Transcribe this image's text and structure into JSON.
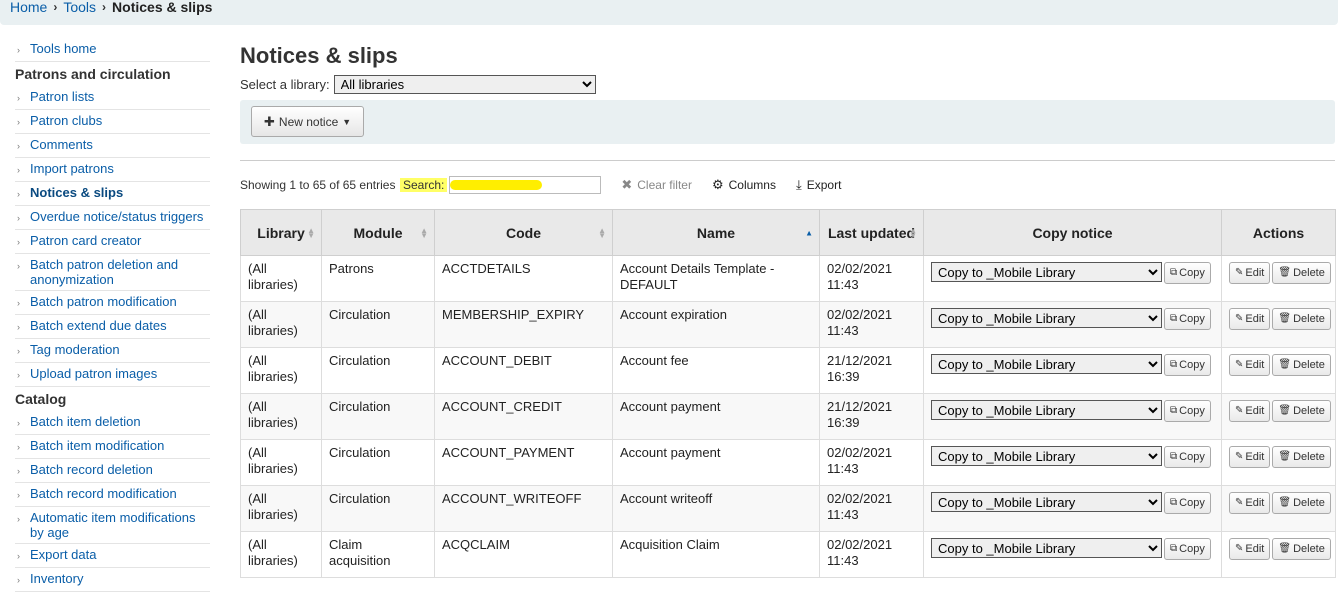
{
  "breadcrumb": {
    "home": "Home",
    "tools": "Tools",
    "current": "Notices & slips",
    "separator": "›"
  },
  "sidebar": {
    "tools_home": "Tools home",
    "sections": [
      {
        "heading": "Patrons and circulation",
        "items": [
          {
            "label": "Patron lists"
          },
          {
            "label": "Patron clubs"
          },
          {
            "label": "Comments"
          },
          {
            "label": "Import patrons"
          },
          {
            "label": "Notices & slips",
            "active": true
          },
          {
            "label": "Overdue notice/status triggers"
          },
          {
            "label": "Patron card creator"
          },
          {
            "label": "Batch patron deletion and anonymization"
          },
          {
            "label": "Batch patron modification"
          },
          {
            "label": "Batch extend due dates"
          },
          {
            "label": "Tag moderation"
          },
          {
            "label": "Upload patron images"
          }
        ]
      },
      {
        "heading": "Catalog",
        "items": [
          {
            "label": "Batch item deletion"
          },
          {
            "label": "Batch item modification"
          },
          {
            "label": "Batch record deletion"
          },
          {
            "label": "Batch record modification"
          },
          {
            "label": "Automatic item modifications by age"
          },
          {
            "label": "Export data"
          },
          {
            "label": "Inventory"
          }
        ]
      }
    ]
  },
  "main": {
    "title": "Notices & slips",
    "library_label": "Select a library:",
    "library_selected": "All libraries",
    "new_notice_label": "New notice"
  },
  "controls": {
    "info": "Showing 1 to 65 of 65 entries",
    "search_label": "Search:",
    "clear_filter": "Clear filter",
    "columns": "Columns",
    "export": "Export"
  },
  "table": {
    "headers": [
      "Library",
      "Module",
      "Code",
      "Name",
      "Last updated",
      "Copy notice",
      "Actions"
    ],
    "copy_option": "Copy to _Mobile Library",
    "copy_btn": "Copy",
    "edit_btn": "Edit",
    "delete_btn": "Delete",
    "rows": [
      {
        "library": "(All libraries)",
        "module": "Patrons",
        "code": "ACCTDETAILS",
        "name": "Account Details Template - DEFAULT",
        "updated": "02/02/2021 11:43"
      },
      {
        "library": "(All libraries)",
        "module": "Circulation",
        "code": "MEMBERSHIP_EXPIRY",
        "name": "Account expiration",
        "updated": "02/02/2021 11:43"
      },
      {
        "library": "(All libraries)",
        "module": "Circulation",
        "code": "ACCOUNT_DEBIT",
        "name": "Account fee",
        "updated": "21/12/2021 16:39"
      },
      {
        "library": "(All libraries)",
        "module": "Circulation",
        "code": "ACCOUNT_CREDIT",
        "name": "Account payment",
        "updated": "21/12/2021 16:39"
      },
      {
        "library": "(All libraries)",
        "module": "Circulation",
        "code": "ACCOUNT_PAYMENT",
        "name": "Account payment",
        "updated": "02/02/2021 11:43"
      },
      {
        "library": "(All libraries)",
        "module": "Circulation",
        "code": "ACCOUNT_WRITEOFF",
        "name": "Account writeoff",
        "updated": "02/02/2021 11:43"
      },
      {
        "library": "(All libraries)",
        "module": "Claim acquisition",
        "code": "ACQCLAIM",
        "name": "Acquisition Claim",
        "updated": "02/02/2021 11:43"
      }
    ]
  },
  "colors": {
    "link": "#0a5ea8",
    "toolbar_bg": "#e9f0f2",
    "highlight": "#ffee00"
  }
}
